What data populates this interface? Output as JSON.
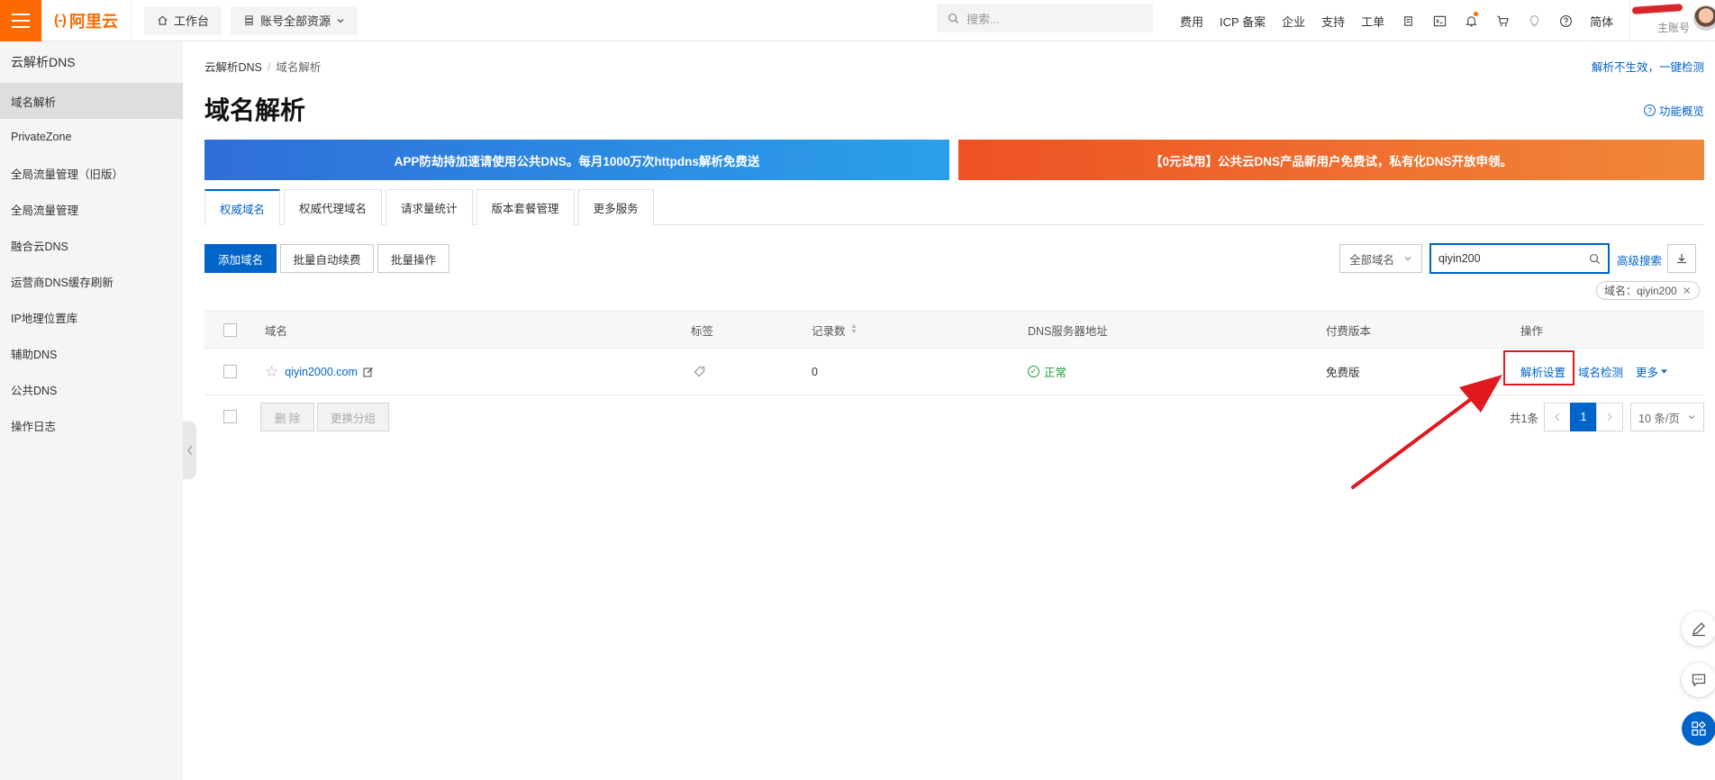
{
  "topbar": {
    "brand": "阿里云",
    "brand_mark": "(-)",
    "workbench": "工作台",
    "resources": "账号全部资源",
    "search_placeholder": "搜索...",
    "links": [
      "费用",
      "ICP 备案",
      "企业",
      "支持",
      "工单"
    ],
    "language": "简体",
    "account_sub": "主账号"
  },
  "sidebar": {
    "title": "云解析DNS",
    "items": [
      {
        "label": "域名解析"
      },
      {
        "label": "PrivateZone"
      },
      {
        "label": "全局流量管理（旧版）"
      },
      {
        "label": "全局流量管理"
      },
      {
        "label": "融合云DNS"
      },
      {
        "label": "运营商DNS缓存刷新"
      },
      {
        "label": "IP地理位置库"
      },
      {
        "label": "辅助DNS"
      },
      {
        "label": "公共DNS"
      },
      {
        "label": "操作日志"
      }
    ]
  },
  "breadcrumb": {
    "root": "云解析DNS",
    "separator": "/",
    "current": "域名解析"
  },
  "header": {
    "title": "域名解析",
    "detect_link": "解析不生效，一键检测",
    "overview_link": "功能概览"
  },
  "banners": {
    "left": "APP防劫持加速请使用公共DNS。每月1000万次httpdns解析免费送",
    "right": "【0元试用】公共云DNS产品新用户免费试，私有化DNS开放申领。"
  },
  "tabs": [
    "权威域名",
    "权威代理域名",
    "请求量统计",
    "版本套餐管理",
    "更多服务"
  ],
  "toolbar": {
    "add": "添加域名",
    "renew": "批量自动续费",
    "batch": "批量操作",
    "scope": "全部域名",
    "search_value": "qiyin200",
    "advanced": "高级搜索",
    "filter_tag": "域名：qiyin200"
  },
  "table": {
    "columns": {
      "domain": "域名",
      "tag": "标签",
      "records": "记录数",
      "dns": "DNS服务器地址",
      "edition": "付费版本",
      "ops": "操作"
    },
    "rows": [
      {
        "domain": "qiyin2000.com",
        "records": "0",
        "dns_status": "正常",
        "edition": "免费版",
        "op_settings": "解析设置",
        "op_check": "域名检测",
        "op_more": "更多"
      }
    ]
  },
  "footer": {
    "delete": "删 除",
    "change_group": "更换分组",
    "total": "共1条",
    "page": "1",
    "page_size": "10 条/页"
  },
  "colors": {
    "brand_orange": "#ff6a00",
    "primary_blue": "#0064c8",
    "status_green": "#1ea035",
    "highlight_red": "#e0191f"
  }
}
